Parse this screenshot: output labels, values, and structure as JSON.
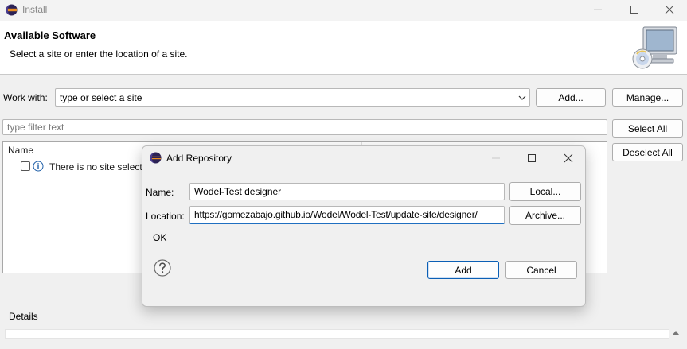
{
  "window": {
    "title": "Install",
    "controls": [
      "minimize-icon",
      "maximize-icon",
      "close-icon"
    ]
  },
  "header": {
    "title": "Available Software",
    "description": "Select a site or enter the location of a site."
  },
  "work_with": {
    "label": "Work with:",
    "placeholder": "type or select a site",
    "add_label": "Add...",
    "manage_label": "Manage..."
  },
  "filter": {
    "placeholder": "type filter text"
  },
  "buttons": {
    "select_all": "Select All",
    "deselect_all": "Deselect All"
  },
  "table": {
    "column_name": "Name",
    "row_text": "There is no site selecte"
  },
  "details": {
    "label": "Details"
  },
  "dialog": {
    "title": "Add Repository",
    "name_label": "Name:",
    "name_value": "Wodel-Test designer",
    "local_label": "Local...",
    "location_label": "Location:",
    "location_value": "https://gomezabajo.github.io/Wodel/Wodel-Test/update-site/designer/",
    "archive_label": "Archive...",
    "status": "OK",
    "add_label": "Add",
    "cancel_label": "Cancel"
  },
  "colors": {
    "accent": "#1f6fc1",
    "background": "#f0f0f0",
    "eclipse_dark": "#2c2255",
    "eclipse_orange": "#f7941e"
  }
}
